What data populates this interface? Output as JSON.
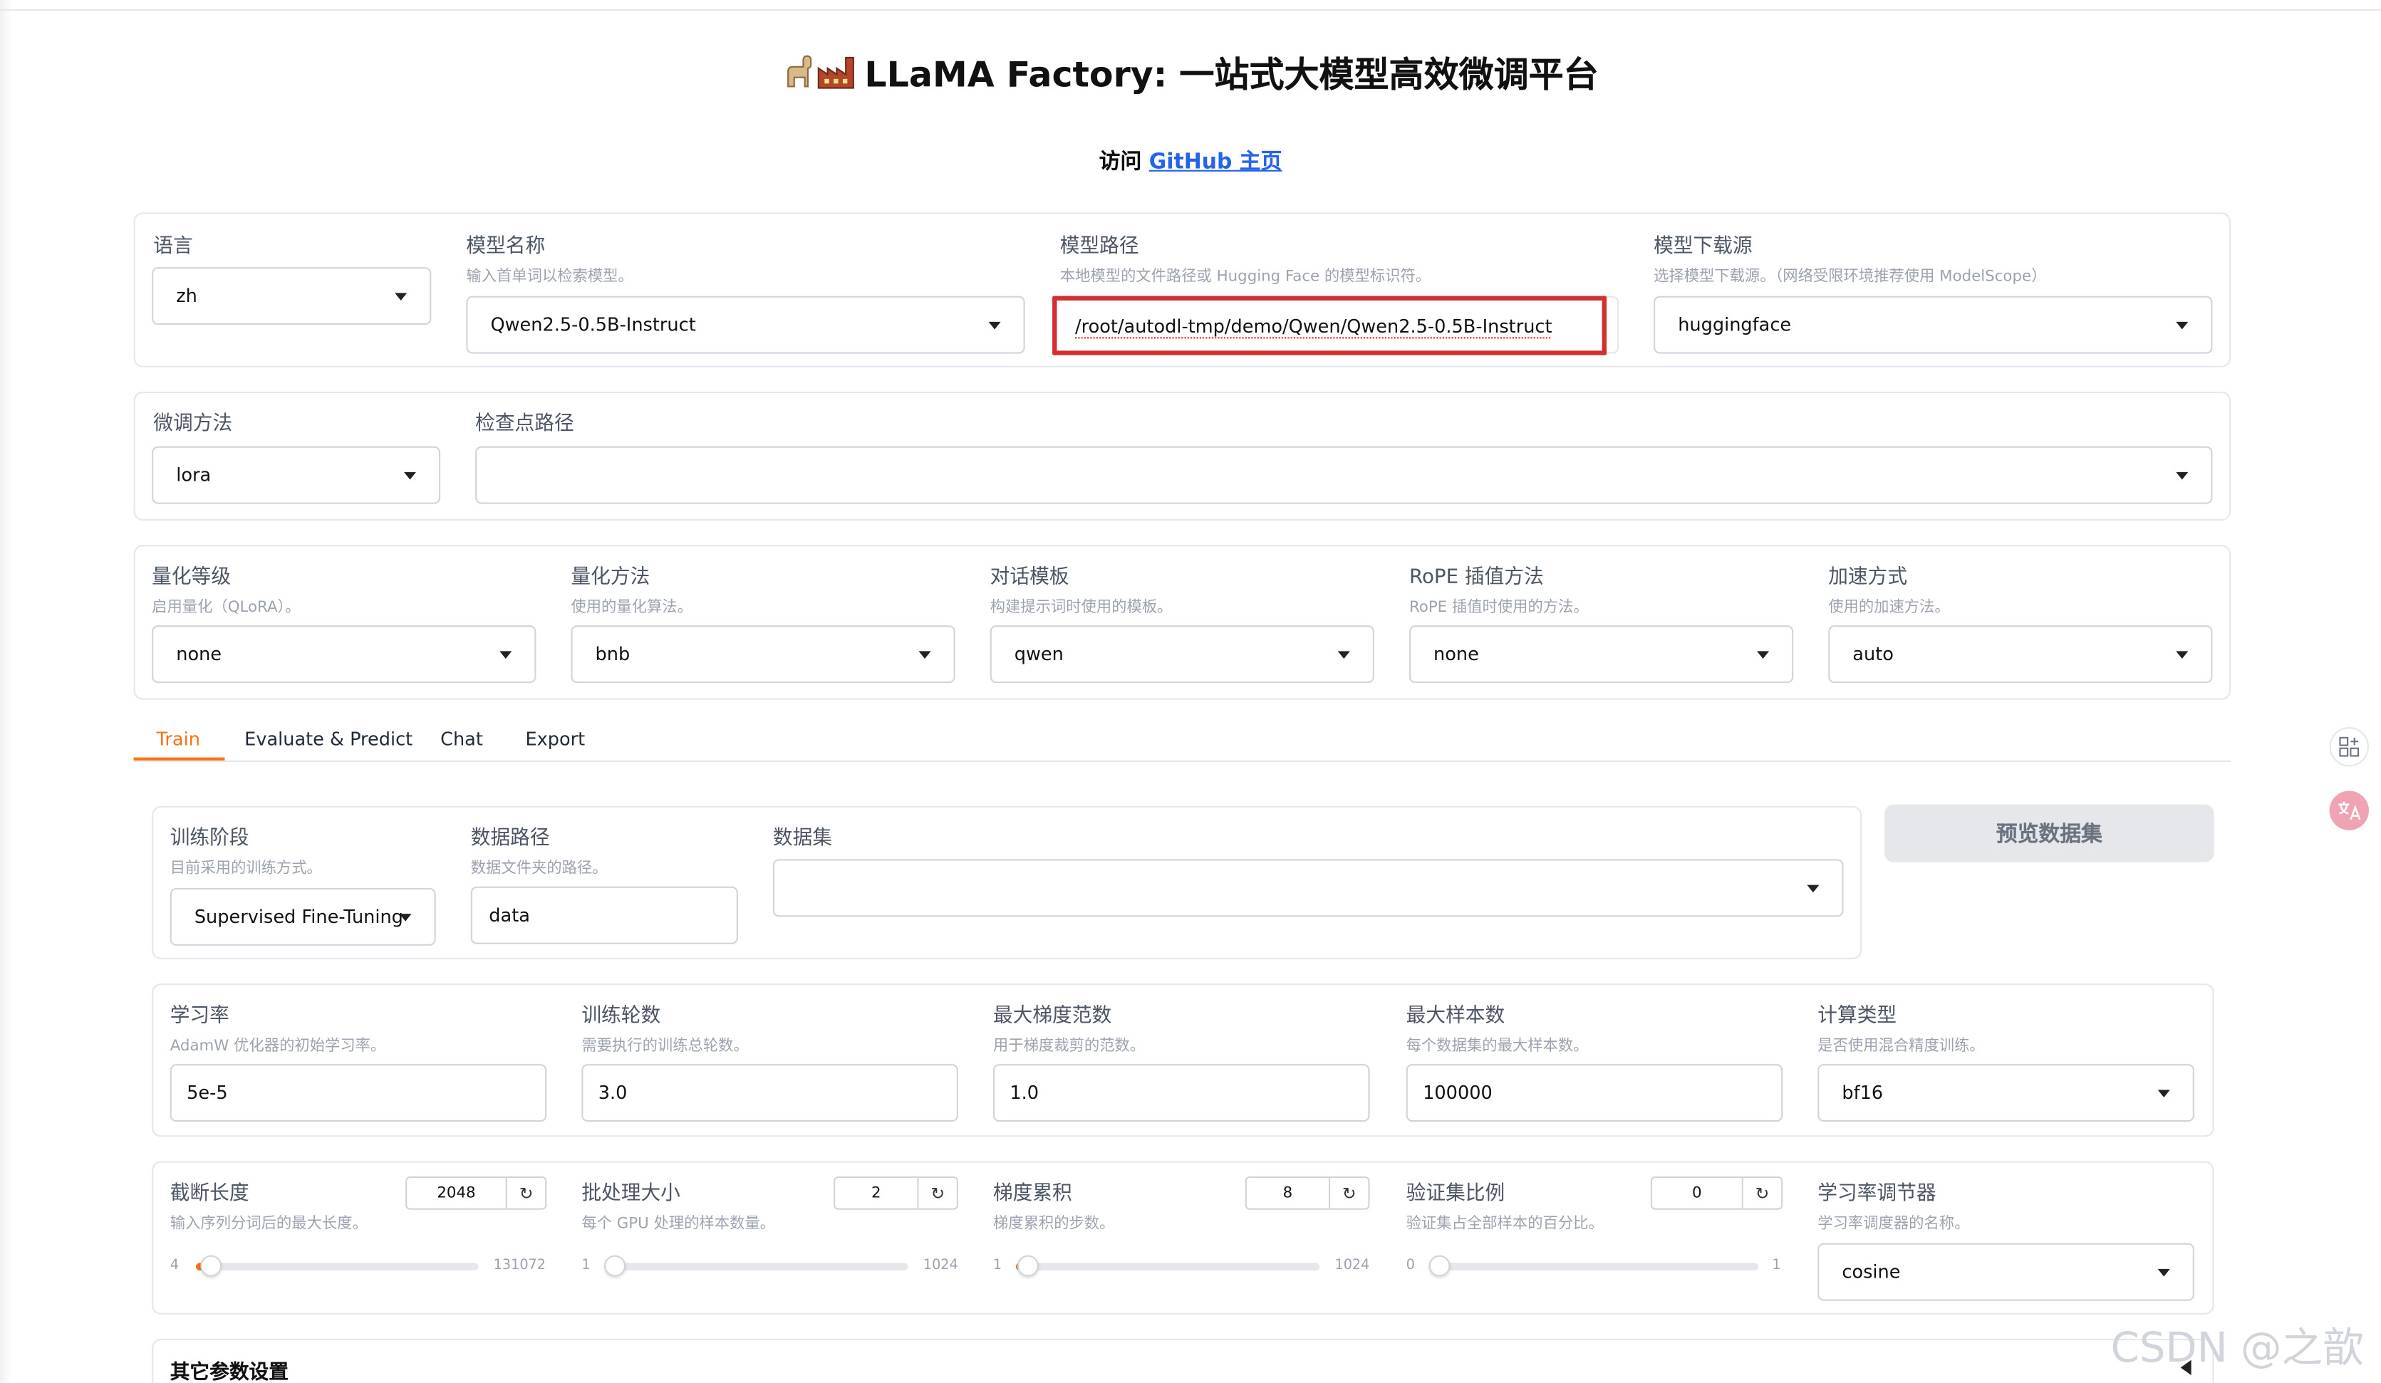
{
  "header": {
    "title": "LLaMA Factory: 一站式大模型高效微调平台",
    "visit_prefix": "访问",
    "github_link": "GitHub 主页"
  },
  "model": {
    "lang": {
      "label": "语言",
      "value": "zh"
    },
    "name": {
      "label": "模型名称",
      "info": "输入首单词以检索模型。",
      "value": "Qwen2.5-0.5B-Instruct"
    },
    "path": {
      "label": "模型路径",
      "info": "本地模型的文件路径或 Hugging Face 的模型标识符。",
      "value": "/root/autodl-tmp/demo/Qwen/Qwen2.5-0.5B-Instruct"
    },
    "hub": {
      "label": "模型下载源",
      "info": "选择模型下载源。（网络受限环境推荐使用 ModelScope）",
      "value": "huggingface"
    }
  },
  "finetune": {
    "method": {
      "label": "微调方法",
      "value": "lora"
    },
    "checkpoint": {
      "label": "检查点路径",
      "value": ""
    }
  },
  "advanced": {
    "quant_bit": {
      "label": "量化等级",
      "info": "启用量化（QLoRA）。",
      "value": "none"
    },
    "quant_method": {
      "label": "量化方法",
      "info": "使用的量化算法。",
      "value": "bnb"
    },
    "template": {
      "label": "对话模板",
      "info": "构建提示词时使用的模板。",
      "value": "qwen"
    },
    "rope": {
      "label": "RoPE 插值方法",
      "info": "RoPE 插值时使用的方法。",
      "value": "none"
    },
    "booster": {
      "label": "加速方式",
      "info": "使用的加速方法。",
      "value": "auto"
    }
  },
  "tabs": [
    "Train",
    "Evaluate & Predict",
    "Chat",
    "Export"
  ],
  "train": {
    "stage": {
      "label": "训练阶段",
      "info": "目前采用的训练方式。",
      "value": "Supervised Fine-Tuning"
    },
    "dataset_dir": {
      "label": "数据路径",
      "info": "数据文件夹的路径。",
      "value": "data"
    },
    "dataset": {
      "label": "数据集",
      "value": ""
    },
    "preview_button": "预览数据集",
    "lr": {
      "label": "学习率",
      "info": "AdamW 优化器的初始学习率。",
      "value": "5e-5"
    },
    "epochs": {
      "label": "训练轮数",
      "info": "需要执行的训练总轮数。",
      "value": "3.0"
    },
    "max_grad_norm": {
      "label": "最大梯度范数",
      "info": "用于梯度裁剪的范数。",
      "value": "1.0"
    },
    "max_samples": {
      "label": "最大样本数",
      "info": "每个数据集的最大样本数。",
      "value": "100000"
    },
    "compute_type": {
      "label": "计算类型",
      "info": "是否使用混合精度训练。",
      "value": "bf16"
    },
    "cutoff_len": {
      "label": "截断长度",
      "info": "输入序列分词后的最大长度。",
      "value": "2048",
      "min": "4",
      "max": "131072",
      "level": 0.0156
    },
    "batch_size": {
      "label": "批处理大小",
      "info": "每个 GPU 处理的样本数量。",
      "value": "2",
      "min": "1",
      "max": "1024",
      "level": 0.001
    },
    "grad_accum": {
      "label": "梯度累积",
      "info": "梯度累积的步数。",
      "value": "8",
      "min": "1",
      "max": "1024",
      "level": 0.007
    },
    "val_size": {
      "label": "验证集比例",
      "info": "验证集占全部样本的百分比。",
      "value": "0",
      "min": "0",
      "max": "1",
      "level": 0
    },
    "lr_scheduler": {
      "label": "学习率调节器",
      "info": "学习率调度器的名称。",
      "value": "cosine"
    },
    "extra_label": "其它参数设置"
  },
  "watermark": "CSDN @之歆",
  "colors": {
    "accent": "#f97316",
    "highlight": "#d32f2f",
    "link": "#2563eb"
  }
}
